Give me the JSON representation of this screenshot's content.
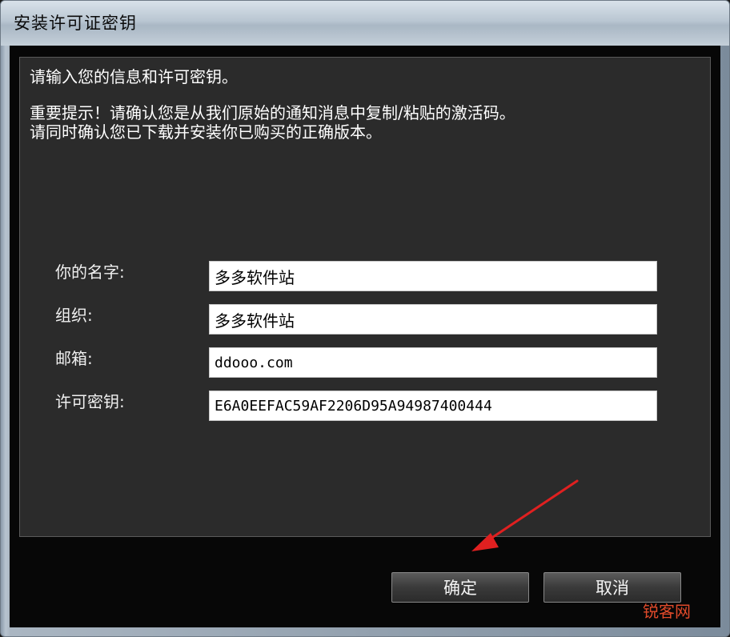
{
  "window": {
    "title": "安装许可证密钥"
  },
  "panel": {
    "intro": "请输入您的信息和许可密钥。",
    "notice_line1": "重要提示！请确认您是从我们原始的通知消息中复制/粘贴的激活码。",
    "notice_line2": "请同时确认您已下载并安装你已购买的正确版本。"
  },
  "form": {
    "name_label": "你的名字:",
    "name_value": "多多软件站",
    "org_label": "组织:",
    "org_value": "多多软件站",
    "email_label": "邮箱:",
    "email_value": "ddooo.com",
    "key_label": "许可密钥:",
    "key_value": "E6A0EEFAC59AF2206D95A94987400444"
  },
  "buttons": {
    "ok": "确定",
    "cancel": "取消"
  },
  "watermark": "锐客网",
  "colors": {
    "annotation_arrow": "#e02020"
  }
}
